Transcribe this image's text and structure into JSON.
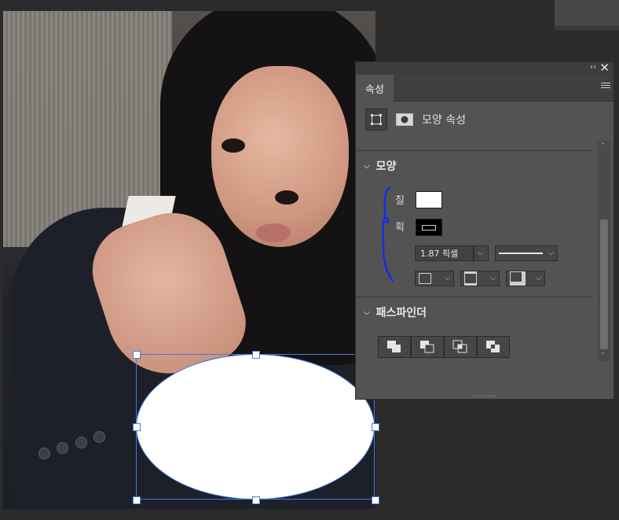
{
  "panel": {
    "tab_label": "속성",
    "header_label": "모양 속성",
    "shape_section": {
      "title": "모양",
      "fill_label": "칠",
      "stroke_label": "획",
      "stroke_width": "1.87 픽셀"
    },
    "pathfinder_section": {
      "title": "패스파인더"
    }
  },
  "colors": {
    "fill_color": "#ffffff",
    "stroke_color": "#000000",
    "selection_color": "#3a6fd8",
    "annotation_color": "#1030e0"
  },
  "icons": {
    "collapse": "double-chevron-left-icon",
    "close": "close-icon",
    "panel_menu": "hamburger-menu-icon",
    "shape_props": "transform-icon",
    "mask_props": "mask-icon",
    "section_toggle": "chevron-down-icon",
    "align_stroke": "stroke-align-icon",
    "caps": "line-caps-icon",
    "corners": "line-corners-icon",
    "pathfinder_ops": [
      "unite-shapes-icon",
      "subtract-front-icon",
      "intersect-icon",
      "exclude-overlap-icon"
    ]
  },
  "glyphs": {
    "collapse": "‹‹",
    "close": "✕",
    "chevron_down": "⌵",
    "scroll_up": "⌃",
    "scroll_down": "⌄",
    "dropdown": "⌵"
  }
}
